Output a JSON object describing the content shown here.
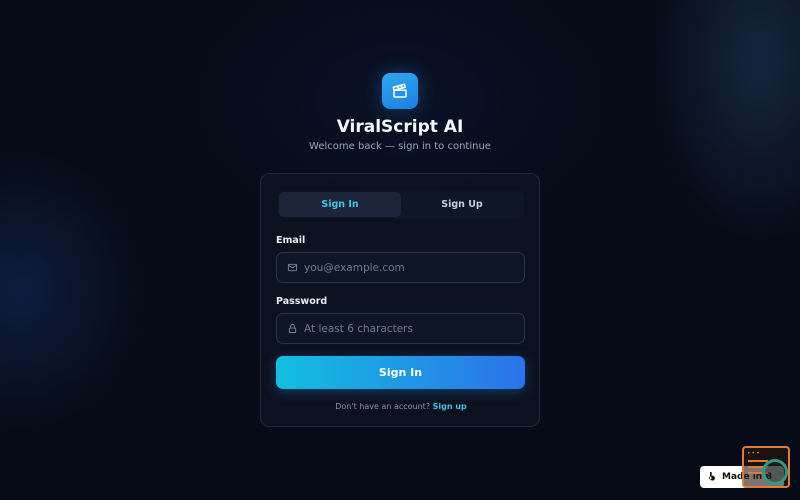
{
  "app": {
    "title": "ViralScript AI",
    "subtitle": "Welcome back — sign in to continue",
    "logo_icon": "clapperboard-icon"
  },
  "tabs": [
    {
      "label": "Sign In",
      "active": true
    },
    {
      "label": "Sign Up",
      "active": false
    }
  ],
  "form": {
    "email_label": "Email",
    "email_placeholder": "you@example.com",
    "email_value": "",
    "password_label": "Password",
    "password_placeholder": "At least 6 characters",
    "password_value": "",
    "submit_label": "Sign In"
  },
  "footer": {
    "prompt": "Don't have an account?",
    "link": "Sign up"
  },
  "badge": {
    "label": "Made in B"
  },
  "colors": {
    "background": "#070b17",
    "accent": "#3fc6e8",
    "button_start": "#13bfe0",
    "button_end": "#2b72ea"
  }
}
